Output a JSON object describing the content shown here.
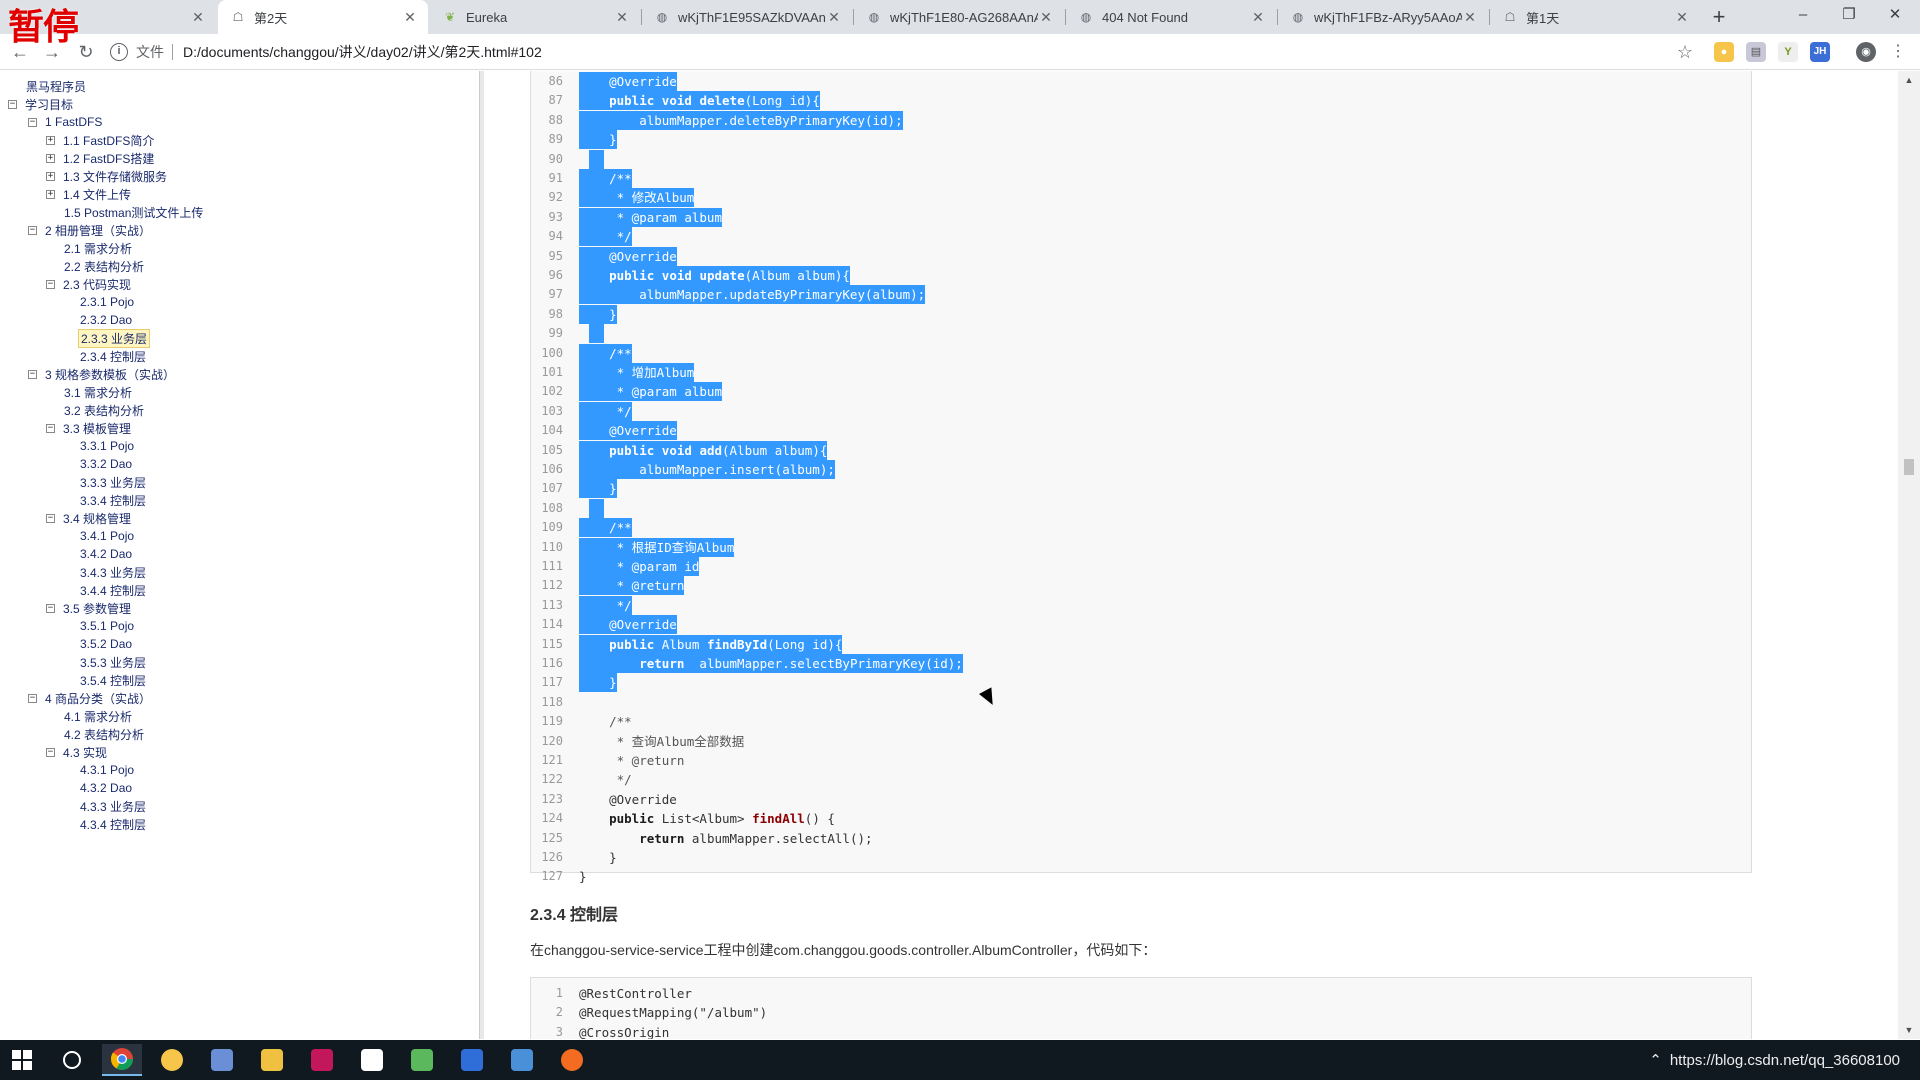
{
  "pause_badge": "暂停",
  "tabs": [
    {
      "title": "",
      "active": false
    },
    {
      "title": "第2天",
      "active": true
    },
    {
      "title": "Eureka",
      "active": false
    },
    {
      "title": "wKjThF1E95SAZkDVAAnA",
      "active": false
    },
    {
      "title": "wKjThF1E80-AG268AAnA",
      "active": false
    },
    {
      "title": "404 Not Found",
      "active": false
    },
    {
      "title": "wKjThF1FBz-ARyy5AAoA",
      "active": false
    },
    {
      "title": "第1天",
      "active": false
    }
  ],
  "address": {
    "scheme_label": "文件",
    "url": "D:/documents/changgou/讲义/day02/讲义/第2天.html#102"
  },
  "extensions": [
    "bookmark-star-icon",
    "ext-fire-icon",
    "ext-pdf-icon",
    "ext-y-icon",
    "ext-jh-icon",
    "account-icon",
    "menu-icon"
  ],
  "toc": [
    {
      "label": "黑马程序员",
      "level": 0,
      "box": ""
    },
    {
      "label": "学习目标",
      "level": 0,
      "box": "−"
    },
    {
      "label": "1 FastDFS",
      "level": 1,
      "box": "−"
    },
    {
      "label": "1.1 FastDFS简介",
      "level": 2,
      "box": "+"
    },
    {
      "label": "1.2 FastDFS搭建",
      "level": 2,
      "box": "+"
    },
    {
      "label": "1.3 文件存储微服务",
      "level": 2,
      "box": "+"
    },
    {
      "label": "1.4 文件上传",
      "level": 2,
      "box": "+"
    },
    {
      "label": "1.5 Postman测试文件上传",
      "level": 2,
      "box": ""
    },
    {
      "label": "2 相册管理（实战）",
      "level": 1,
      "box": "−"
    },
    {
      "label": "2.1 需求分析",
      "level": 2,
      "box": ""
    },
    {
      "label": "2.2 表结构分析",
      "level": 2,
      "box": ""
    },
    {
      "label": "2.3 代码实现",
      "level": 2,
      "box": "−"
    },
    {
      "label": "2.3.1 Pojo",
      "level": 3,
      "box": ""
    },
    {
      "label": "2.3.2 Dao",
      "level": 3,
      "box": ""
    },
    {
      "label": "2.3.3 业务层",
      "level": 3,
      "box": "",
      "selected": true
    },
    {
      "label": "2.3.4 控制层",
      "level": 3,
      "box": ""
    },
    {
      "label": "3 规格参数模板（实战）",
      "level": 1,
      "box": "−"
    },
    {
      "label": "3.1 需求分析",
      "level": 2,
      "box": ""
    },
    {
      "label": "3.2 表结构分析",
      "level": 2,
      "box": ""
    },
    {
      "label": "3.3 模板管理",
      "level": 2,
      "box": "−"
    },
    {
      "label": "3.3.1 Pojo",
      "level": 3,
      "box": ""
    },
    {
      "label": "3.3.2 Dao",
      "level": 3,
      "box": ""
    },
    {
      "label": "3.3.3 业务层",
      "level": 3,
      "box": ""
    },
    {
      "label": "3.3.4 控制层",
      "level": 3,
      "box": ""
    },
    {
      "label": "3.4 规格管理",
      "level": 2,
      "box": "−"
    },
    {
      "label": "3.4.1 Pojo",
      "level": 3,
      "box": ""
    },
    {
      "label": "3.4.2 Dao",
      "level": 3,
      "box": ""
    },
    {
      "label": "3.4.3 业务层",
      "level": 3,
      "box": ""
    },
    {
      "label": "3.4.4 控制层",
      "level": 3,
      "box": ""
    },
    {
      "label": "3.5 参数管理",
      "level": 2,
      "box": "−"
    },
    {
      "label": "3.5.1 Pojo",
      "level": 3,
      "box": ""
    },
    {
      "label": "3.5.2 Dao",
      "level": 3,
      "box": ""
    },
    {
      "label": "3.5.3 业务层",
      "level": 3,
      "box": ""
    },
    {
      "label": "3.5.4 控制层",
      "level": 3,
      "box": ""
    },
    {
      "label": "4 商品分类（实战）",
      "level": 1,
      "box": "−"
    },
    {
      "label": "4.1 需求分析",
      "level": 2,
      "box": ""
    },
    {
      "label": "4.2 表结构分析",
      "level": 2,
      "box": ""
    },
    {
      "label": "4.3 实现",
      "level": 2,
      "box": "−"
    },
    {
      "label": "4.3.1 Pojo",
      "level": 3,
      "box": ""
    },
    {
      "label": "4.3.2 Dao",
      "level": 3,
      "box": ""
    },
    {
      "label": "4.3.3 业务层",
      "level": 3,
      "box": ""
    },
    {
      "label": "4.3.4 控制层",
      "level": 3,
      "box": ""
    }
  ],
  "code1": [
    {
      "n": "86",
      "t": "    @Override",
      "hl": true
    },
    {
      "n": "87",
      "t": "    public void delete(Long id){",
      "hl": true
    },
    {
      "n": "88",
      "t": "        albumMapper.deleteByPrimaryKey(id);",
      "hl": true
    },
    {
      "n": "89",
      "t": "    }",
      "hl": true
    },
    {
      "n": "90",
      "t": "",
      "hl": true
    },
    {
      "n": "91",
      "t": "    /**",
      "hl": true
    },
    {
      "n": "92",
      "t": "     * 修改Album",
      "hl": true
    },
    {
      "n": "93",
      "t": "     * @param album",
      "hl": true
    },
    {
      "n": "94",
      "t": "     */",
      "hl": true
    },
    {
      "n": "95",
      "t": "    @Override",
      "hl": true
    },
    {
      "n": "96",
      "t": "    public void update(Album album){",
      "hl": true
    },
    {
      "n": "97",
      "t": "        albumMapper.updateByPrimaryKey(album);",
      "hl": true
    },
    {
      "n": "98",
      "t": "    }",
      "hl": true
    },
    {
      "n": "99",
      "t": "",
      "hl": true
    },
    {
      "n": "100",
      "t": "    /**",
      "hl": true
    },
    {
      "n": "101",
      "t": "     * 增加Album",
      "hl": true
    },
    {
      "n": "102",
      "t": "     * @param album",
      "hl": true
    },
    {
      "n": "103",
      "t": "     */",
      "hl": true
    },
    {
      "n": "104",
      "t": "    @Override",
      "hl": true
    },
    {
      "n": "105",
      "t": "    public void add(Album album){",
      "hl": true
    },
    {
      "n": "106",
      "t": "        albumMapper.insert(album);",
      "hl": true
    },
    {
      "n": "107",
      "t": "    }",
      "hl": true
    },
    {
      "n": "108",
      "t": "",
      "hl": true
    },
    {
      "n": "109",
      "t": "    /**",
      "hl": true
    },
    {
      "n": "110",
      "t": "     * 根据ID查询Album",
      "hl": true
    },
    {
      "n": "111",
      "t": "     * @param id",
      "hl": true
    },
    {
      "n": "112",
      "t": "     * @return",
      "hl": true
    },
    {
      "n": "113",
      "t": "     */",
      "hl": true
    },
    {
      "n": "114",
      "t": "    @Override",
      "hl": true
    },
    {
      "n": "115",
      "t": "    public Album findById(Long id){",
      "hl": true
    },
    {
      "n": "116",
      "t": "        return  albumMapper.selectByPrimaryKey(id);",
      "hl": true
    },
    {
      "n": "117",
      "t": "    }",
      "hl": true
    },
    {
      "n": "118",
      "t": "",
      "hl": false
    },
    {
      "n": "119",
      "t": "    /**",
      "hl": false
    },
    {
      "n": "120",
      "t": "     * 查询Album全部数据",
      "hl": false
    },
    {
      "n": "121",
      "t": "     * @return",
      "hl": false
    },
    {
      "n": "122",
      "t": "     */",
      "hl": false
    },
    {
      "n": "123",
      "t": "    @Override",
      "hl": false
    },
    {
      "n": "124",
      "t": "    public List<Album> findAll() {",
      "hl": false
    },
    {
      "n": "125",
      "t": "        return albumMapper.selectAll();",
      "hl": false
    },
    {
      "n": "126",
      "t": "    }",
      "hl": false
    },
    {
      "n": "127",
      "t": "}",
      "hl": false
    }
  ],
  "section_heading": "2.3.4 控制层",
  "section_para": "在changgou-service-service工程中创建com.changgou.goods.controller.AlbumController，代码如下：",
  "code2": [
    {
      "n": "1",
      "t": "@RestController"
    },
    {
      "n": "2",
      "t": "@RequestMapping(\"/album\")"
    },
    {
      "n": "3",
      "t": "@CrossOrigin"
    }
  ],
  "tray_text": "https://blog.csdn.net/qq_36608100",
  "colors": {
    "selection": "#3399ff",
    "tab_strip": "#dee1e6",
    "taskbar": "#101820"
  }
}
